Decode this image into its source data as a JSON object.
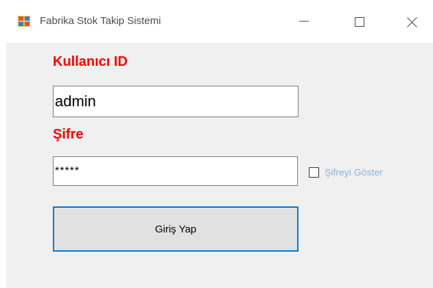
{
  "window": {
    "title": "Fabrika Stok Takip Sistemi",
    "icon": "form-app-icon",
    "controls": [
      "minimize-icon",
      "maximize-icon",
      "close-icon"
    ]
  },
  "form": {
    "user_label": "Kullanıcı ID",
    "user_value": "admin",
    "password_label": "Şifre",
    "password_value": "*****",
    "show_password_label": "Şifreyi Göster",
    "show_password_checked": false,
    "login_button": "Giriş Yap"
  },
  "colors": {
    "label_red": "#ff0000",
    "focus_blue": "#0078d7",
    "checkbox_label": "#8fb3d9",
    "client_bg": "#f0f0f0"
  }
}
